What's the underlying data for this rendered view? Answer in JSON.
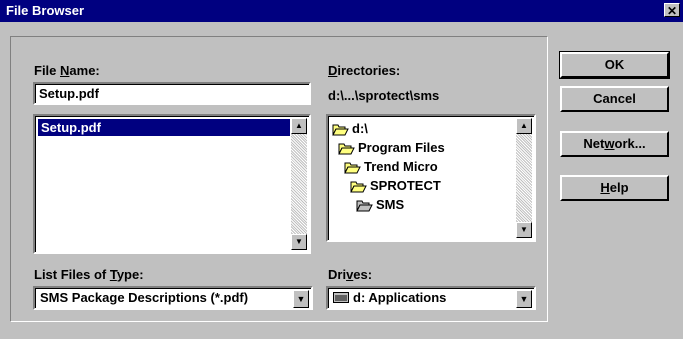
{
  "window": {
    "title": "File Browser",
    "close_glyph": "✕"
  },
  "file_name": {
    "label_pre": "File ",
    "label_key": "N",
    "label_post": "ame:",
    "value": "Setup.pdf"
  },
  "file_list": {
    "items": [
      "Setup.pdf"
    ],
    "selected_index": 0
  },
  "directories": {
    "label_key": "D",
    "label_post": "irectories:",
    "path": "d:\\...\\sprotect\\sms",
    "items": [
      {
        "name": "d:\\",
        "icon": "folder-open-icon"
      },
      {
        "name": "Program Files",
        "icon": "folder-open-icon"
      },
      {
        "name": "Trend Micro",
        "icon": "folder-open-icon"
      },
      {
        "name": "SPROTECT",
        "icon": "folder-open-icon"
      },
      {
        "name": "SMS",
        "icon": "folder-open-icon",
        "current": true
      }
    ]
  },
  "file_type": {
    "label_pre": "List Files of ",
    "label_key": "T",
    "label_post": "ype:",
    "value": "SMS Package Descriptions (*.pdf)"
  },
  "drives": {
    "label_pre": "Dri",
    "label_key": "v",
    "label_post": "es:",
    "value": "d: Applications",
    "icon": "drive-icon"
  },
  "buttons": {
    "ok": "OK",
    "cancel": "Cancel",
    "network_pre": "Net",
    "network_key": "w",
    "network_post": "ork...",
    "help_key": "H",
    "help_post": "elp"
  },
  "colors": {
    "titlebar": "#000080",
    "face": "#c0c0c0",
    "selection": "#000080"
  }
}
